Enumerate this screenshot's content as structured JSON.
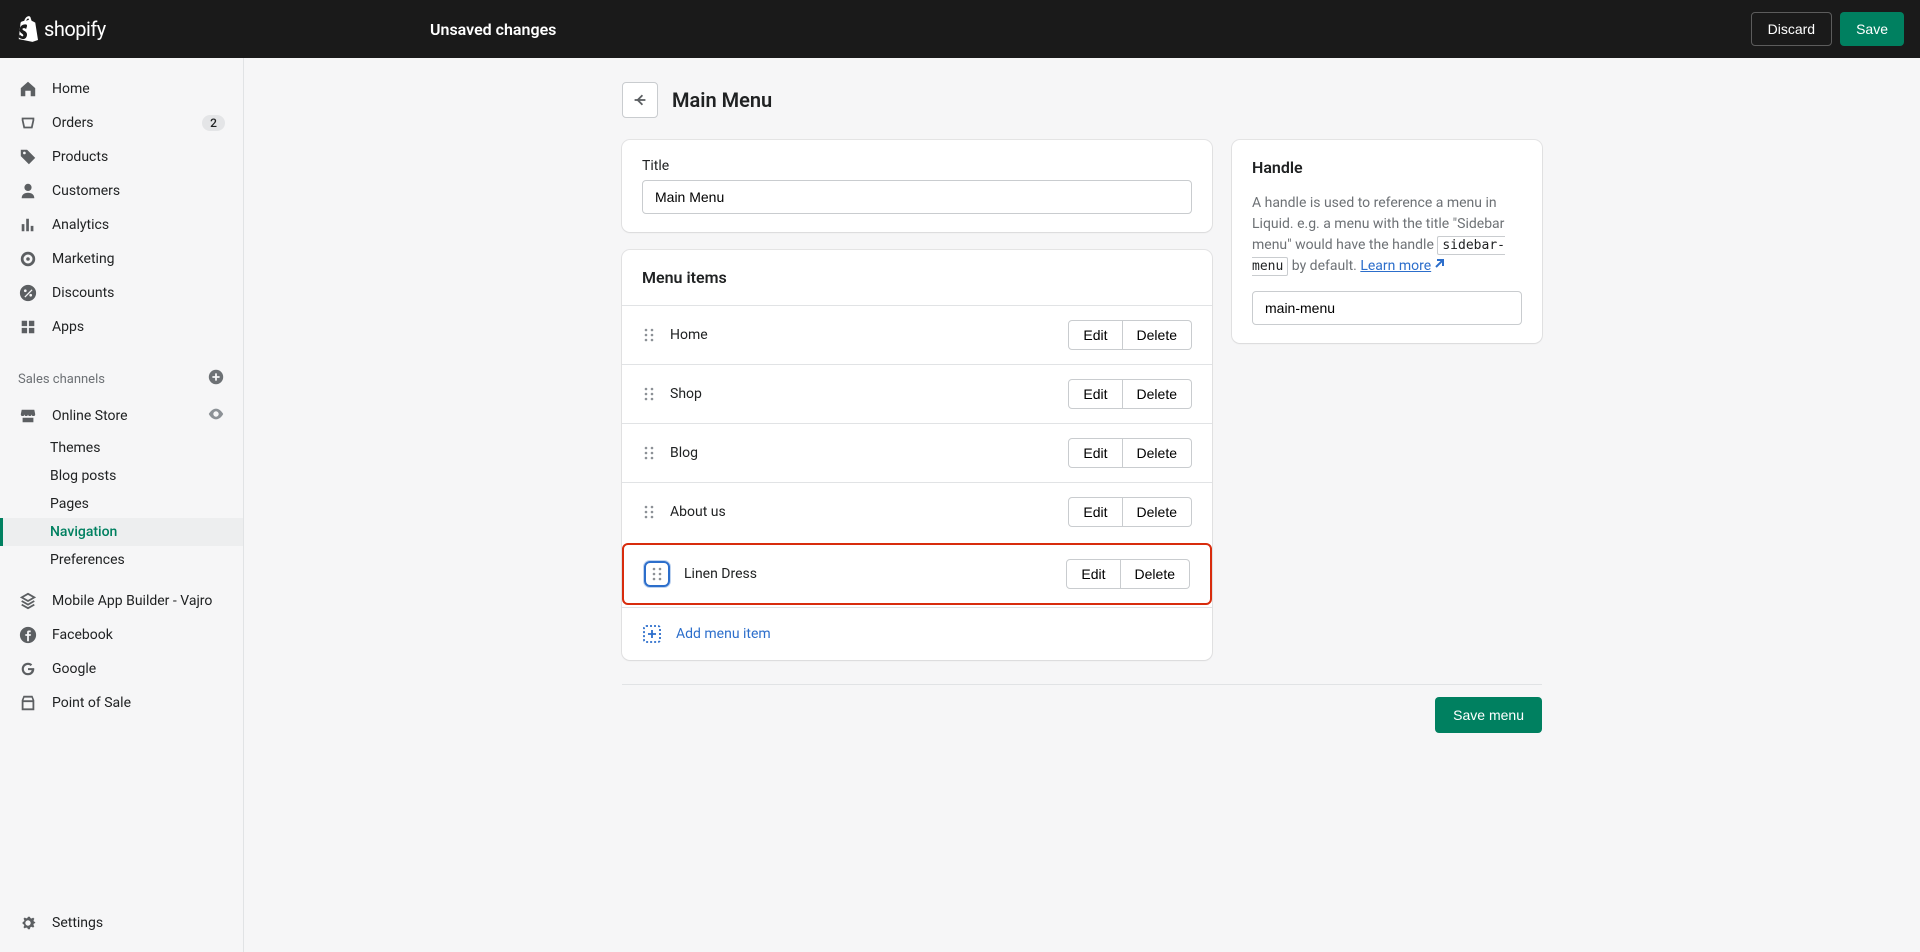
{
  "topbar": {
    "brand": "shopify",
    "status": "Unsaved changes",
    "discard": "Discard",
    "save": "Save"
  },
  "sidebar": {
    "primary": [
      {
        "label": "Home",
        "icon": "home"
      },
      {
        "label": "Orders",
        "icon": "orders",
        "badge": "2"
      },
      {
        "label": "Products",
        "icon": "tag"
      },
      {
        "label": "Customers",
        "icon": "person"
      },
      {
        "label": "Analytics",
        "icon": "analytics"
      },
      {
        "label": "Marketing",
        "icon": "target"
      },
      {
        "label": "Discounts",
        "icon": "discount"
      },
      {
        "label": "Apps",
        "icon": "apps"
      }
    ],
    "section_label": "Sales channels",
    "online_store": "Online Store",
    "online_sub": [
      {
        "label": "Themes"
      },
      {
        "label": "Blog posts"
      },
      {
        "label": "Pages"
      },
      {
        "label": "Navigation",
        "active": true
      },
      {
        "label": "Preferences"
      }
    ],
    "channels": [
      {
        "label": "Mobile App Builder - Vajro",
        "icon": "mobile"
      },
      {
        "label": "Facebook",
        "icon": "facebook"
      },
      {
        "label": "Google",
        "icon": "google"
      },
      {
        "label": "Point of Sale",
        "icon": "pos"
      }
    ],
    "settings": "Settings"
  },
  "page": {
    "title": "Main Menu",
    "title_label": "Title",
    "title_value": "Main Menu",
    "menu_items_title": "Menu items",
    "edit": "Edit",
    "delete": "Delete",
    "items": [
      {
        "label": "Home"
      },
      {
        "label": "Shop"
      },
      {
        "label": "Blog"
      },
      {
        "label": "About us"
      },
      {
        "label": "Linen Dress",
        "highlighted": true
      }
    ],
    "add_item": "Add menu item",
    "save_menu": "Save menu"
  },
  "handle": {
    "title": "Handle",
    "desc_1": "A handle is used to reference a menu in Liquid. e.g. a menu with the title \"Sidebar menu\" would have the handle ",
    "code": "sidebar-menu",
    "desc_2": " by default. ",
    "learn_more": "Learn more",
    "value": "main-menu"
  }
}
